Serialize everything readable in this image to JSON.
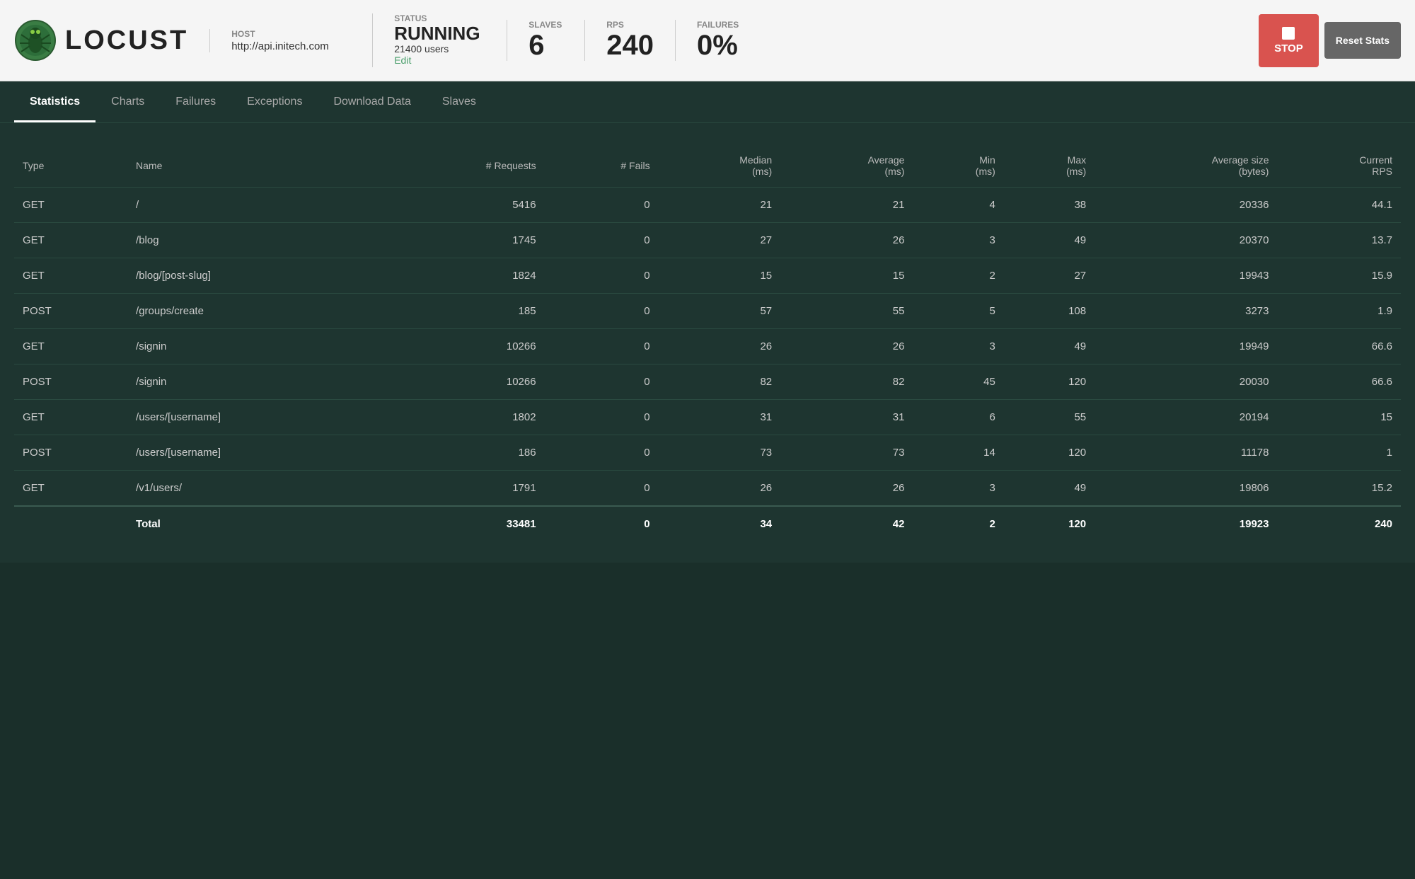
{
  "header": {
    "logo_text": "LOCUST",
    "host_label": "HOST",
    "host_value": "http://api.initech.com",
    "status_label": "STATUS",
    "status_running": "RUNNING",
    "status_users": "21400 users",
    "status_edit": "Edit",
    "slaves_label": "SLAVES",
    "slaves_value": "6",
    "rps_label": "RPS",
    "rps_value": "240",
    "failures_label": "FAILURES",
    "failures_value": "0%",
    "stop_label": "STOP",
    "reset_label": "Reset Stats"
  },
  "nav": {
    "tabs": [
      {
        "label": "Statistics",
        "active": true
      },
      {
        "label": "Charts",
        "active": false
      },
      {
        "label": "Failures",
        "active": false
      },
      {
        "label": "Exceptions",
        "active": false
      },
      {
        "label": "Download Data",
        "active": false
      },
      {
        "label": "Slaves",
        "active": false
      }
    ]
  },
  "table": {
    "columns": [
      "Type",
      "Name",
      "# Requests",
      "# Fails",
      "Median (ms)",
      "Average (ms)",
      "Min (ms)",
      "Max (ms)",
      "Average size (bytes)",
      "Current RPS"
    ],
    "rows": [
      {
        "type": "GET",
        "name": "/",
        "requests": "5416",
        "fails": "0",
        "median": "21",
        "average": "21",
        "min": "4",
        "max": "38",
        "avg_size": "20336",
        "rps": "44.1"
      },
      {
        "type": "GET",
        "name": "/blog",
        "requests": "1745",
        "fails": "0",
        "median": "27",
        "average": "26",
        "min": "3",
        "max": "49",
        "avg_size": "20370",
        "rps": "13.7"
      },
      {
        "type": "GET",
        "name": "/blog/[post-slug]",
        "requests": "1824",
        "fails": "0",
        "median": "15",
        "average": "15",
        "min": "2",
        "max": "27",
        "avg_size": "19943",
        "rps": "15.9"
      },
      {
        "type": "POST",
        "name": "/groups/create",
        "requests": "185",
        "fails": "0",
        "median": "57",
        "average": "55",
        "min": "5",
        "max": "108",
        "avg_size": "3273",
        "rps": "1.9"
      },
      {
        "type": "GET",
        "name": "/signin",
        "requests": "10266",
        "fails": "0",
        "median": "26",
        "average": "26",
        "min": "3",
        "max": "49",
        "avg_size": "19949",
        "rps": "66.6"
      },
      {
        "type": "POST",
        "name": "/signin",
        "requests": "10266",
        "fails": "0",
        "median": "82",
        "average": "82",
        "min": "45",
        "max": "120",
        "avg_size": "20030",
        "rps": "66.6"
      },
      {
        "type": "GET",
        "name": "/users/[username]",
        "requests": "1802",
        "fails": "0",
        "median": "31",
        "average": "31",
        "min": "6",
        "max": "55",
        "avg_size": "20194",
        "rps": "15"
      },
      {
        "type": "POST",
        "name": "/users/[username]",
        "requests": "186",
        "fails": "0",
        "median": "73",
        "average": "73",
        "min": "14",
        "max": "120",
        "avg_size": "11178",
        "rps": "1"
      },
      {
        "type": "GET",
        "name": "/v1/users/",
        "requests": "1791",
        "fails": "0",
        "median": "26",
        "average": "26",
        "min": "3",
        "max": "49",
        "avg_size": "19806",
        "rps": "15.2"
      }
    ],
    "total": {
      "label": "Total",
      "requests": "33481",
      "fails": "0",
      "median": "34",
      "average": "42",
      "min": "2",
      "max": "120",
      "avg_size": "19923",
      "rps": "240"
    }
  }
}
